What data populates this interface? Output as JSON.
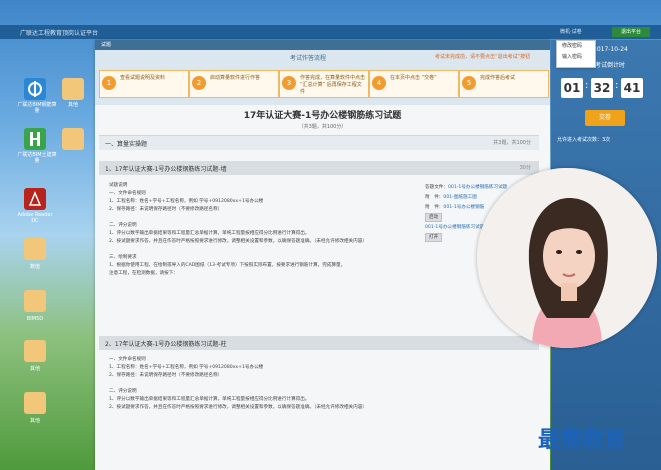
{
  "app": {
    "title": "广联达工程教育顶岗认证平台",
    "exit_label": "退出平台",
    "user_menu": "微机·试卷"
  },
  "desktop": {
    "icons": [
      {
        "label": "广联达BIM钢筋算量",
        "color": "#2a87d6"
      },
      {
        "label": "其他",
        "color": "#f2c77a"
      },
      {
        "label": "广联达BIM土建算量",
        "color": "#3aa548"
      },
      {
        "label": "",
        "color": "#f2c77a"
      },
      {
        "label": "Adobe Reader DC",
        "color": "#b8231e"
      },
      {
        "label": "数值",
        "color": "#f2c77a"
      },
      {
        "label": "BIM5D",
        "color": "#f2c77a"
      },
      {
        "label": "其他",
        "color": "#f2c77a"
      },
      {
        "label": "其他",
        "color": "#f2c77a"
      }
    ]
  },
  "window": {
    "bar_title": "试题"
  },
  "process": {
    "title": "考试作答流程",
    "notice": "考试未完成前，请不要点击“退出考试”按钮",
    "steps": [
      {
        "num": "1",
        "text": "查看试题说明及资料"
      },
      {
        "num": "2",
        "text": "启动算量软件进行作答"
      },
      {
        "num": "3",
        "text": "作答完成，在算量软件中点击 “汇总计算” 后再保存工程文件"
      },
      {
        "num": "4",
        "text": "在本页中点击 “交卷”"
      },
      {
        "num": "5",
        "text": "完成作答后考试"
      }
    ]
  },
  "paper": {
    "title": "17年认证大赛-1号办公楼钢筋练习试题",
    "subtitle": "（共3题，共100分）",
    "section": "一、算量实操题",
    "section_info": "共3题，共100分",
    "questions": [
      {
        "title": "1、17年认证大赛-1号办公楼钢筋练习试题-墙",
        "score": "30分",
        "lines": [
          "试题说明",
          "一、文件命名规则",
          "1、工程名称：姓名+学号+工程名称，例如 学号+0912080xx+1号办公楼",
          "2、保存路径：未说明保存路径时（不要修改路径名称）",
          "",
          "二、评分说明",
          "1、评分以数字输出单据结果等和工程量汇总单据计算，单纯工程量按相应得分比例进行计算得出。",
          "2、按试题要求作答，并且在作答时严格按照要求进行修改，调整相关设置和参数，以确保答题准确。（未经允许修改相关内容）",
          "",
          "三、绘制要求",
          "1、根据你使用工程，在绘制或导入的CAD图纸（13-考试专项）下按照实际布置，按要求进行钢筋计算，完成算量，",
          "注意工程，在检测数据，请按下："
        ]
      },
      {
        "title": "2、17年认证大赛-1号办公楼钢筋练习试题-柱",
        "score": "",
        "lines": [
          "一、文件命名规则",
          "1、工程名称：姓名+学号+工程名称，例如 学号+0912080xx+1号办公楼",
          "2、保存路径：未说明保存路径时（不要修改路径名称）",
          "",
          "二、评分说明",
          "1、评分以数字输出单据结果等和工程量汇总单据计算，单纯工程量按相应得分比例进行计算得出。",
          "2、按试题要求作答，并且在作答时严格按照要求进行修改，调整相关设置和参数，以确保答题准确。（未经允许修改相关内容）"
        ]
      }
    ],
    "files": {
      "label_answer": "答题文件：",
      "answer_link": "001-1号办公楼钢筋练习试题",
      "label_attach": "附　件：",
      "attach1": "001-图纸施工图",
      "attach2": "001-1号办公楼钢筋",
      "launch_btn": "启动",
      "open_btn": "打开"
    }
  },
  "timer": {
    "date": "2017-10-24",
    "label": "考试倒计时",
    "hours": "01",
    "minutes": "32",
    "seconds": "41",
    "hand_in": "交卷",
    "allow_text": "允许进入考试次数：3次"
  },
  "dropdown": {
    "items": [
      "修改密码",
      "输入密码"
    ]
  },
  "brand": {
    "text": "最需教育"
  }
}
